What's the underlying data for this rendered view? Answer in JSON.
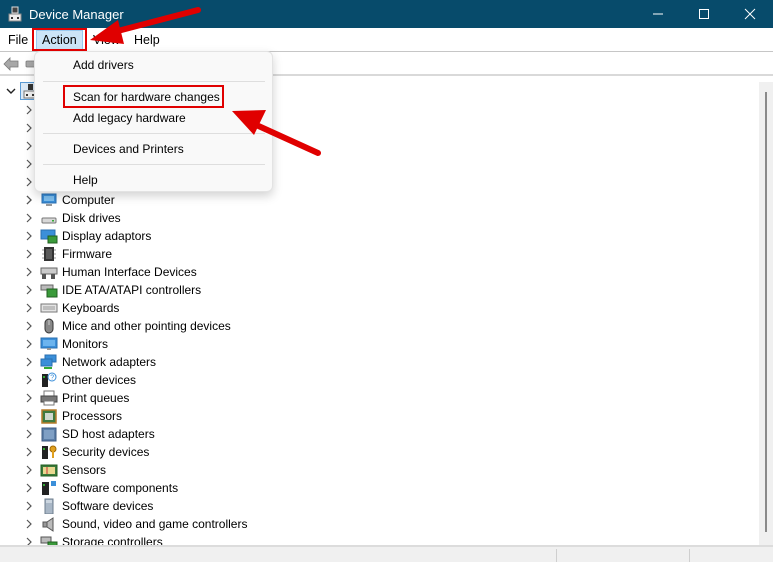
{
  "window": {
    "title": "Device Manager",
    "controls": [
      "minimize",
      "maximize",
      "close"
    ]
  },
  "menubar": {
    "items": [
      {
        "label": "File"
      },
      {
        "label": "Action",
        "active": true
      },
      {
        "label": "View"
      },
      {
        "label": "Help"
      }
    ]
  },
  "action_menu": {
    "items": [
      {
        "label": "Add drivers"
      },
      {
        "label": "Scan for hardware changes",
        "highlighted": true
      },
      {
        "label": "Add legacy hardware"
      },
      {
        "label": "Devices and Printers"
      },
      {
        "label": "Help"
      }
    ]
  },
  "toolbar": {
    "buttons": [
      "back-icon",
      "forward-icon"
    ]
  },
  "tree": {
    "root_expanded": true,
    "root_icon": "computer-root-icon",
    "items": [
      {
        "label": "Computer",
        "icon": "computer-icon"
      },
      {
        "label": "Disk drives",
        "icon": "disk-drive-icon"
      },
      {
        "label": "Display adaptors",
        "icon": "display-adapter-icon"
      },
      {
        "label": "Firmware",
        "icon": "firmware-icon"
      },
      {
        "label": "Human Interface Devices",
        "icon": "hid-icon"
      },
      {
        "label": "IDE ATA/ATAPI controllers",
        "icon": "ide-controller-icon"
      },
      {
        "label": "Keyboards",
        "icon": "keyboard-icon"
      },
      {
        "label": "Mice and other pointing devices",
        "icon": "mouse-icon"
      },
      {
        "label": "Monitors",
        "icon": "monitor-icon"
      },
      {
        "label": "Network adapters",
        "icon": "network-adapter-icon"
      },
      {
        "label": "Other devices",
        "icon": "other-devices-icon"
      },
      {
        "label": "Print queues",
        "icon": "printer-icon"
      },
      {
        "label": "Processors",
        "icon": "processor-icon"
      },
      {
        "label": "SD host adapters",
        "icon": "sd-host-icon"
      },
      {
        "label": "Security devices",
        "icon": "security-device-icon"
      },
      {
        "label": "Sensors",
        "icon": "sensor-icon"
      },
      {
        "label": "Software components",
        "icon": "software-component-icon"
      },
      {
        "label": "Software devices",
        "icon": "software-device-icon"
      },
      {
        "label": "Sound, video and game controllers",
        "icon": "speaker-icon"
      },
      {
        "label": "Storage controllers",
        "icon": "storage-controller-icon"
      }
    ]
  },
  "annotations": {
    "color": "#e00000",
    "highlights": [
      "Action menu",
      "Scan for hardware changes"
    ],
    "arrows": 2
  }
}
